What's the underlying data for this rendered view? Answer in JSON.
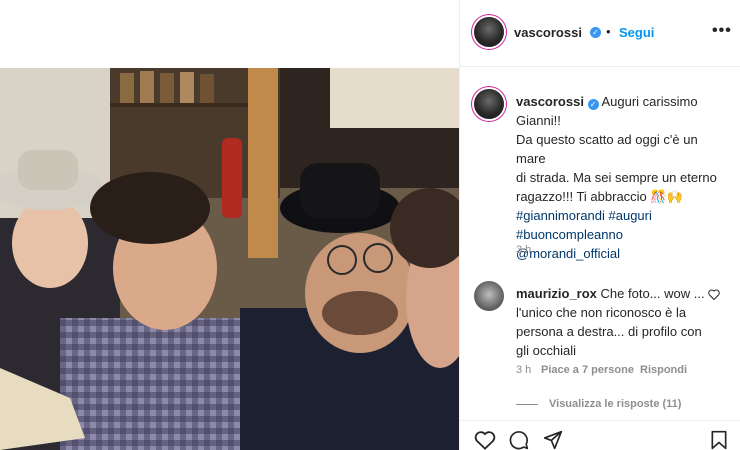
{
  "post": {
    "username": "vascorossi",
    "separator": "•",
    "follow_label": "Segui",
    "more_label": "•••",
    "caption_lines": [
      "Auguri carissimo",
      "Gianni!!",
      "Da questo scatto ad oggi c'è un mare",
      "di strada. Ma sei sempre un eterno",
      "ragazzo!!! Ti abbraccio"
    ],
    "caption_emoji": "🎊🙌",
    "hashtags": [
      "#giannimorandi #auguri",
      "#buoncompleanno",
      "@morandi_official"
    ],
    "time": "3 h"
  },
  "comment": {
    "username": "maurizio_rox",
    "text": "Che foto... wow ... l'unico che non riconosco è la persona a destra... di profilo con gli occhiali",
    "time": "3 h",
    "likes": "Piace a 7 persone",
    "reply_label": "Rispondi",
    "view_replies": "Visualizza le risposte (11)"
  },
  "icons": {
    "like": "heart-icon",
    "comment": "comment-icon",
    "share": "send-icon",
    "save": "bookmark-icon",
    "verified": "verified-badge-icon"
  },
  "colors": {
    "accent": "#0095f6",
    "hashtag": "#00376b",
    "muted": "#8e8e8e",
    "verified": "#3897f0"
  }
}
